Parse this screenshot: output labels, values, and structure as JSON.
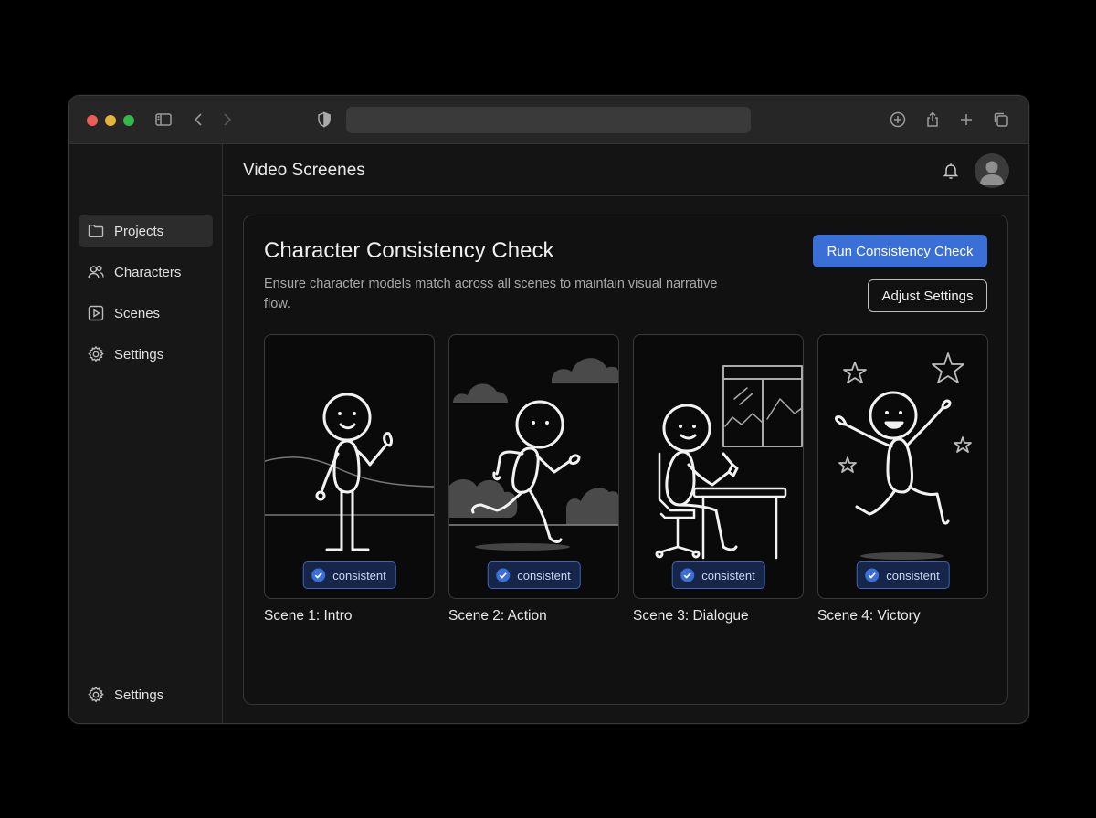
{
  "browser": {
    "url": ""
  },
  "sidebar": {
    "items": [
      {
        "label": "Projects",
        "icon": "folder-icon",
        "active": true
      },
      {
        "label": "Characters",
        "icon": "users-icon",
        "active": false
      },
      {
        "label": "Scenes",
        "icon": "play-icon",
        "active": false
      },
      {
        "label": "Settings",
        "icon": "gear-icon",
        "active": false
      }
    ],
    "footer": {
      "label": "Settings",
      "icon": "gear-icon"
    }
  },
  "header": {
    "title": "Video Screenes"
  },
  "main": {
    "title": "Character Consistency Check",
    "description": "Ensure character models match across all scenes to maintain visual narrative flow.",
    "run_button": "Run Consistency Check",
    "adjust_button": "Adjust Settings",
    "scenes": [
      {
        "label": "Scene 1: Intro",
        "badge": "consistent"
      },
      {
        "label": "Scene 2: Action",
        "badge": "consistent"
      },
      {
        "label": "Scene 3: Dialogue",
        "badge": "consistent"
      },
      {
        "label": "Scene 4: Victory",
        "badge": "consistent"
      }
    ]
  },
  "colors": {
    "accent": "#3a6fd8",
    "badge_border": "#3d64b8",
    "badge_bg": "#16254a",
    "traffic_red": "#ec5f57",
    "traffic_yellow": "#e3b33a",
    "traffic_green": "#33b84a"
  }
}
